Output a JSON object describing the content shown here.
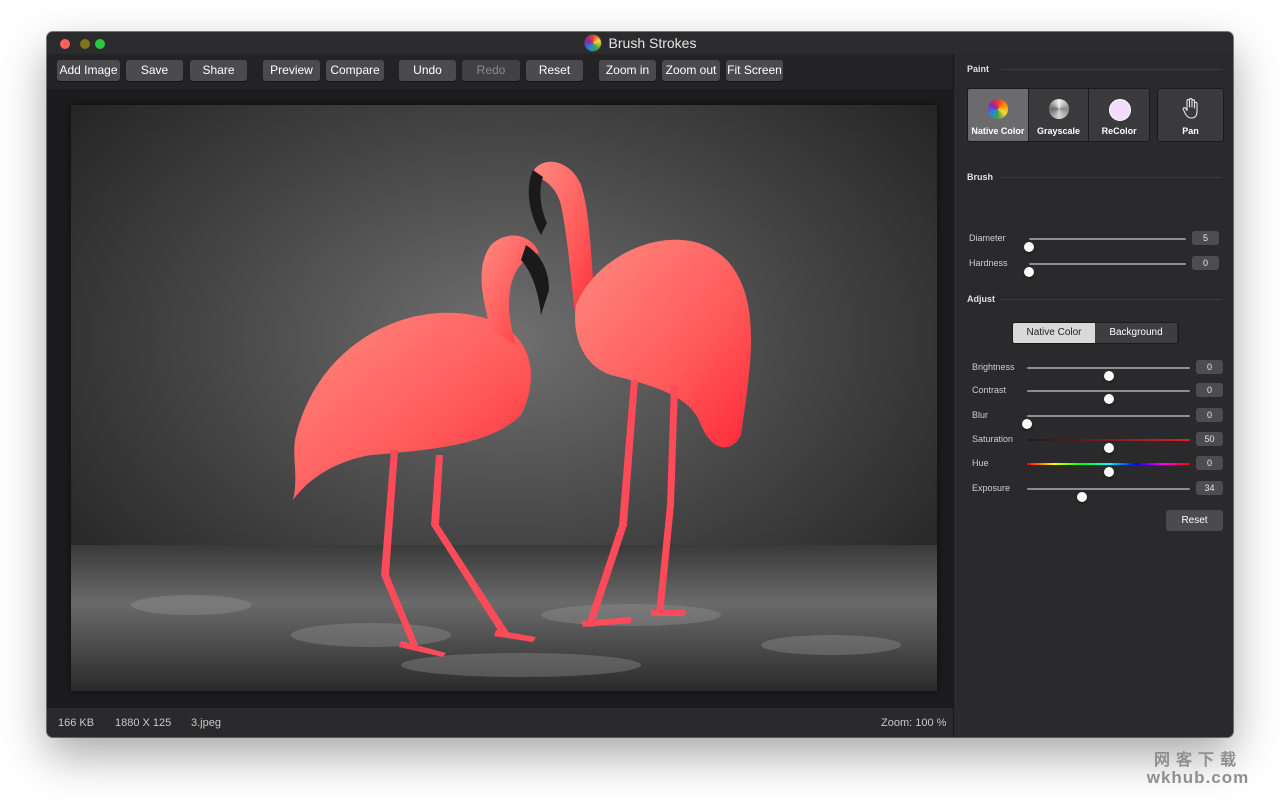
{
  "window": {
    "title": "Brush Strokes"
  },
  "toolbar": {
    "buttons": [
      {
        "label": "Add Image",
        "enabled": true
      },
      {
        "label": "Save",
        "enabled": true
      },
      {
        "label": "Share",
        "enabled": true
      },
      {
        "label": "Preview",
        "enabled": true
      },
      {
        "label": "Compare",
        "enabled": true
      },
      {
        "label": "Undo",
        "enabled": true
      },
      {
        "label": "Redo",
        "enabled": false
      },
      {
        "label": "Reset",
        "enabled": true
      },
      {
        "label": "Zoom in",
        "enabled": true
      },
      {
        "label": "Zoom out",
        "enabled": true
      },
      {
        "label": "Fit Screen",
        "enabled": true
      }
    ]
  },
  "status": {
    "file_size": "166 KB",
    "dimensions": "1880 X 125",
    "file_name": "3.jpeg",
    "zoom": "Zoom: 100 %"
  },
  "sidebar": {
    "paint": {
      "title": "Paint",
      "modes": [
        {
          "label": "Native Color",
          "icon": "color-wheel-icon",
          "active": true
        },
        {
          "label": "Grayscale",
          "icon": "grayscale-icon",
          "active": false
        },
        {
          "label": "ReColor",
          "icon": "recolor-swatch-icon",
          "active": false
        }
      ],
      "pan": {
        "label": "Pan",
        "icon": "hand-icon"
      }
    },
    "brush": {
      "title": "Brush",
      "diameter": {
        "label": "Diameter",
        "value": "5",
        "fraction": 0.0
      },
      "hardness": {
        "label": "Hardness",
        "value": "0",
        "fraction": 0.0
      }
    },
    "adjust": {
      "title": "Adjust",
      "targets": [
        {
          "label": "Native Color",
          "active": true
        },
        {
          "label": "Background",
          "active": false
        }
      ],
      "brightness": {
        "label": "Brightness",
        "value": "0",
        "fraction": 0.5
      },
      "contrast": {
        "label": "Contrast",
        "value": "0",
        "fraction": 0.5
      },
      "blur": {
        "label": "Blur",
        "value": "0",
        "fraction": 0.0
      },
      "saturation": {
        "label": "Saturation",
        "value": "50",
        "fraction": 0.5
      },
      "hue": {
        "label": "Hue",
        "value": "0",
        "fraction": 0.5
      },
      "exposure": {
        "label": "Exposure",
        "value": "34",
        "fraction": 0.34
      },
      "reset_label": "Reset"
    }
  },
  "watermark": {
    "line1": "网客下载",
    "line2": "wkhub.com"
  },
  "colors": {
    "flamingo": "#ff5a5f",
    "accent_dark": "#232325",
    "active_mode": "#6b6b6d"
  }
}
